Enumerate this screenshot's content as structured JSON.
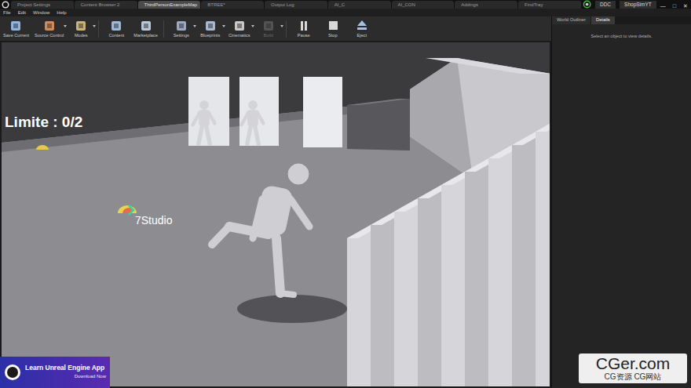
{
  "tabs": [
    {
      "label": "Project Settings",
      "selected": false
    },
    {
      "label": "Content Browser 2",
      "selected": false
    },
    {
      "label": "ThirdPersonExampleMap",
      "selected": true
    },
    {
      "label": "BTREE*",
      "selected": false
    },
    {
      "label": "Output Log",
      "selected": false
    },
    {
      "label": "AI_C",
      "selected": false
    },
    {
      "label": "AI_CON",
      "selected": false
    },
    {
      "label": "Addings",
      "selected": false
    },
    {
      "label": "FindTray",
      "selected": false
    }
  ],
  "title_buttons": [
    "DDC",
    "ShopSimYT"
  ],
  "window_controls": [
    "—",
    "□",
    "✕"
  ],
  "menu": [
    "File",
    "Edit",
    "Window",
    "Help"
  ],
  "toolbar": [
    {
      "label": "Save Current",
      "disabled": false,
      "dropdown": false,
      "color": "#8fb4e0"
    },
    {
      "label": "Source Control",
      "disabled": false,
      "dropdown": true,
      "color": "#d08a5a"
    },
    {
      "label": "Modes",
      "disabled": false,
      "dropdown": true,
      "color": "#c9b27a"
    },
    {
      "label": "Content",
      "disabled": false,
      "dropdown": false,
      "color": "#9fb8d8"
    },
    {
      "label": "Marketplace",
      "disabled": false,
      "dropdown": false,
      "color": "#b8c8d8"
    },
    {
      "label": "Settings",
      "disabled": false,
      "dropdown": true,
      "color": "#9aa8c0"
    },
    {
      "label": "Blueprints",
      "disabled": false,
      "dropdown": true,
      "color": "#a8b8d0"
    },
    {
      "label": "Cinematics",
      "disabled": false,
      "dropdown": true,
      "color": "#c8c8c8"
    },
    {
      "label": "Build",
      "disabled": true,
      "dropdown": true,
      "color": "#9a9a9a"
    },
    {
      "label": "Pause",
      "disabled": false,
      "dropdown": false,
      "color": "#d8d8d8"
    },
    {
      "label": "Stop",
      "disabled": false,
      "dropdown": false,
      "color": "#d8d8d8"
    },
    {
      "label": "Eject",
      "disabled": false,
      "dropdown": false,
      "color": "#a8c0e0"
    }
  ],
  "viewport": {
    "hud": "Limite : 0/2",
    "logo": "7Studio"
  },
  "panel": {
    "tabs": [
      {
        "label": "World Outliner",
        "selected": false
      },
      {
        "label": "Details",
        "selected": true
      }
    ],
    "message": "Select an object to view details."
  },
  "ad": {
    "title": "Learn Unreal Engine App",
    "action": "Download Now"
  },
  "site_watermark": {
    "title": "CGer.com",
    "subtitle": "CG资源 CG网站"
  }
}
